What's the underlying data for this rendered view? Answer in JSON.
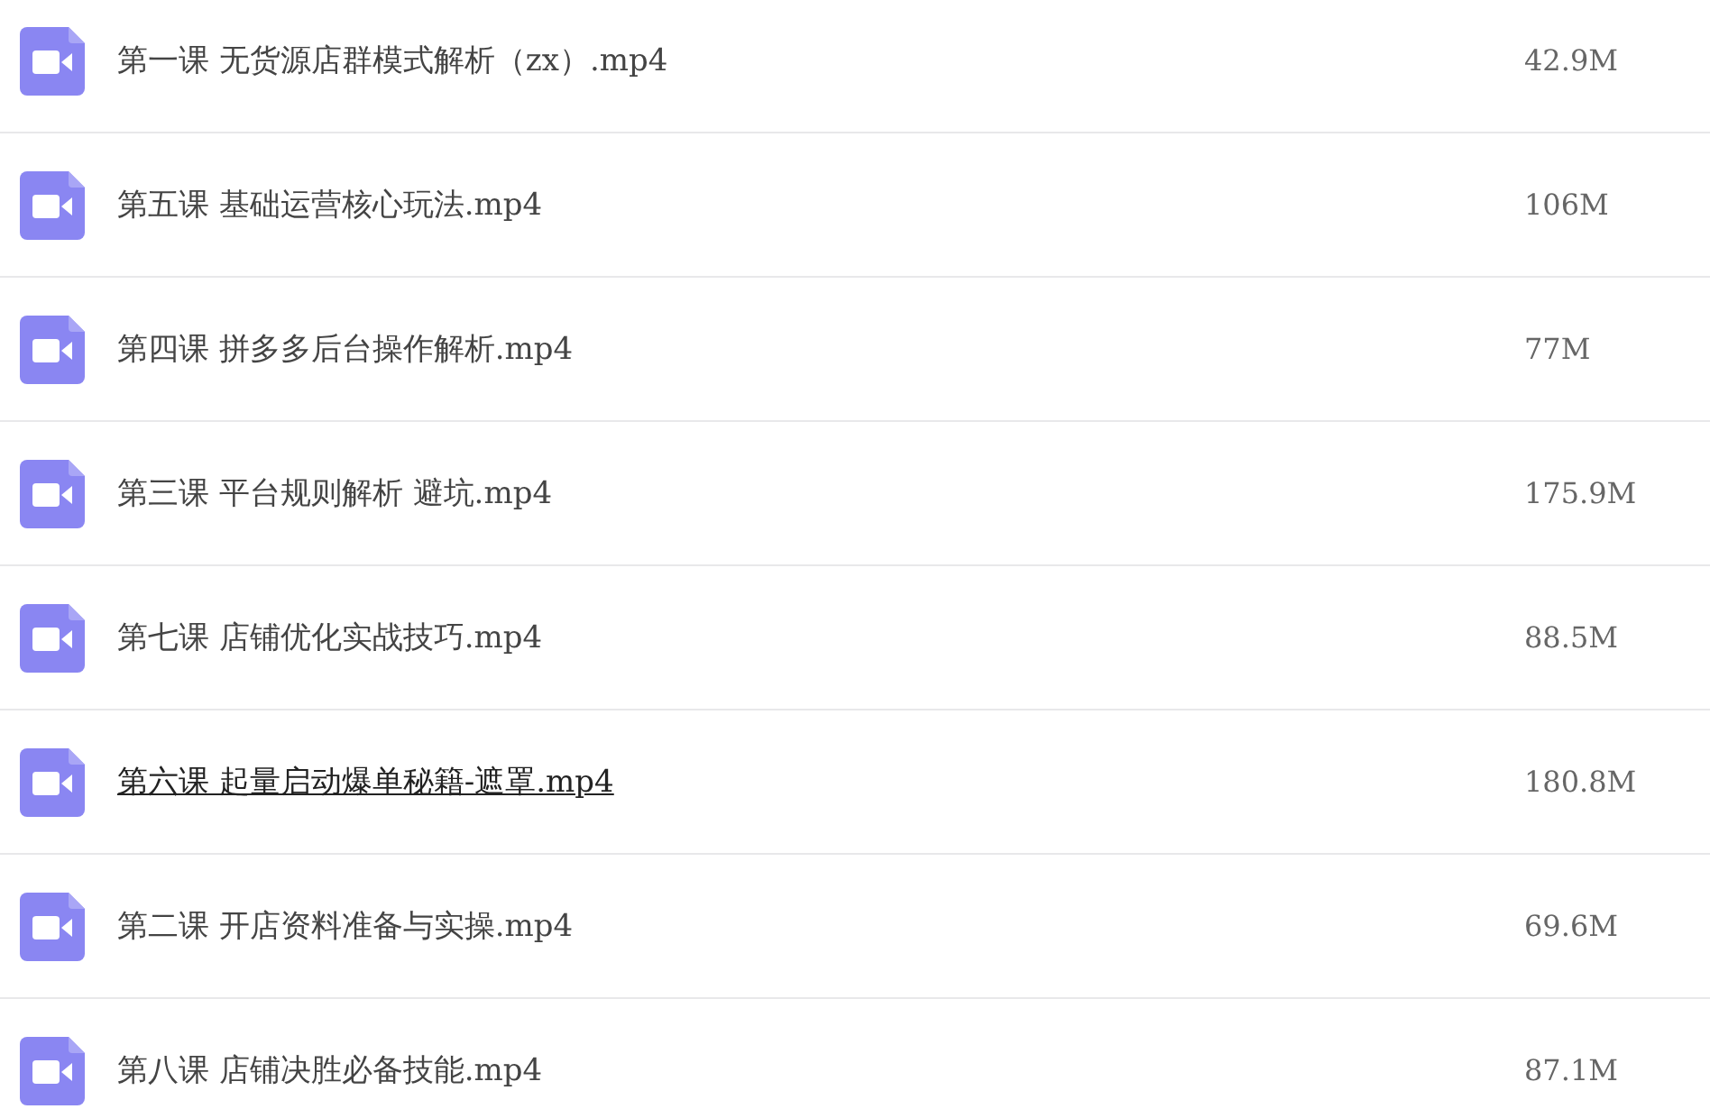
{
  "files": [
    {
      "name": "第一课 无货源店群模式解析（zx）.mp4",
      "size": "42.9M",
      "hovered": false
    },
    {
      "name": "第五课 基础运营核心玩法.mp4",
      "size": "106M",
      "hovered": false
    },
    {
      "name": "第四课 拼多多后台操作解析.mp4",
      "size": "77M",
      "hovered": false
    },
    {
      "name": "第三课 平台规则解析 避坑.mp4",
      "size": "175.9M",
      "hovered": false
    },
    {
      "name": "第七课 店铺优化实战技巧.mp4",
      "size": "88.5M",
      "hovered": false
    },
    {
      "name": "第六课 起量启动爆单秘籍-遮罩.mp4",
      "size": "180.8M",
      "hovered": true
    },
    {
      "name": "第二课 开店资料准备与实操.mp4",
      "size": "69.6M",
      "hovered": false
    },
    {
      "name": "第八课 店铺决胜必备技能.mp4",
      "size": "87.1M",
      "hovered": false
    }
  ]
}
